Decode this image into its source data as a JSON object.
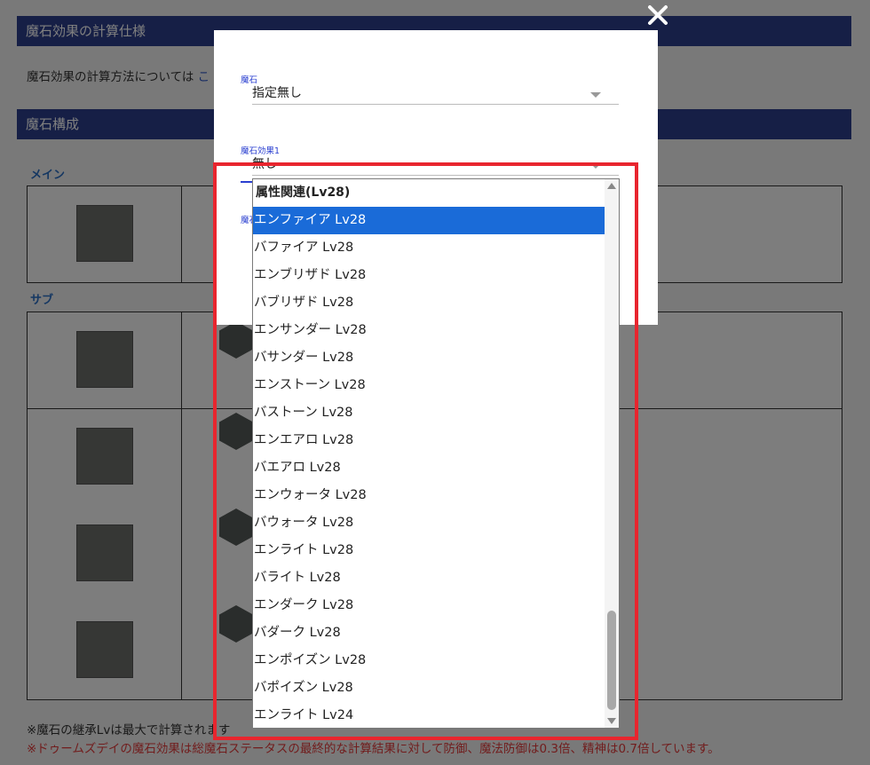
{
  "background": {
    "section1_title": "魔石効果の計算仕様",
    "section1_text": "魔石効果の計算方法については",
    "section1_link": "こ",
    "section2_title": "魔石構成",
    "main_label": "メイン",
    "sub_label": "サブ",
    "note1": "※魔石の継承Lvは最大で計算されます",
    "note2": "※ドゥームズデイの魔石効果は総魔石ステータスの最終的な計算結果に対して防御、魔法防御は0.3倍、精神は0.7倍しています。"
  },
  "modal": {
    "field1_label": "魔石",
    "field1_value": "指定無し",
    "field2_label": "魔石効果1",
    "field2_value": "無し",
    "field3_label": "魔石"
  },
  "dropdown": {
    "group_label": "属性関連(Lv28)",
    "selected_index": 0,
    "options": [
      "エンファイア Lv28",
      "バファイア Lv28",
      "エンブリザド Lv28",
      "バブリザド Lv28",
      "エンサンダー Lv28",
      "バサンダー Lv28",
      "エンストーン Lv28",
      "バストーン Lv28",
      "エンエアロ Lv28",
      "バエアロ Lv28",
      "エンウォータ Lv28",
      "バウォータ Lv28",
      "エンライト Lv28",
      "バライト Lv28",
      "エンダーク Lv28",
      "バダーク Lv28",
      "エンポイズン Lv28",
      "バポイズン Lv28",
      "エンライト Lv24"
    ],
    "scroll_position": 0.82
  },
  "colors": {
    "header": "#2c3f8c",
    "selection": "#1a6bd8",
    "highlight": "#e8252e",
    "label": "#2a3fd0"
  },
  "icons": {
    "close": "close-icon",
    "caret": "chevron-down-icon"
  }
}
